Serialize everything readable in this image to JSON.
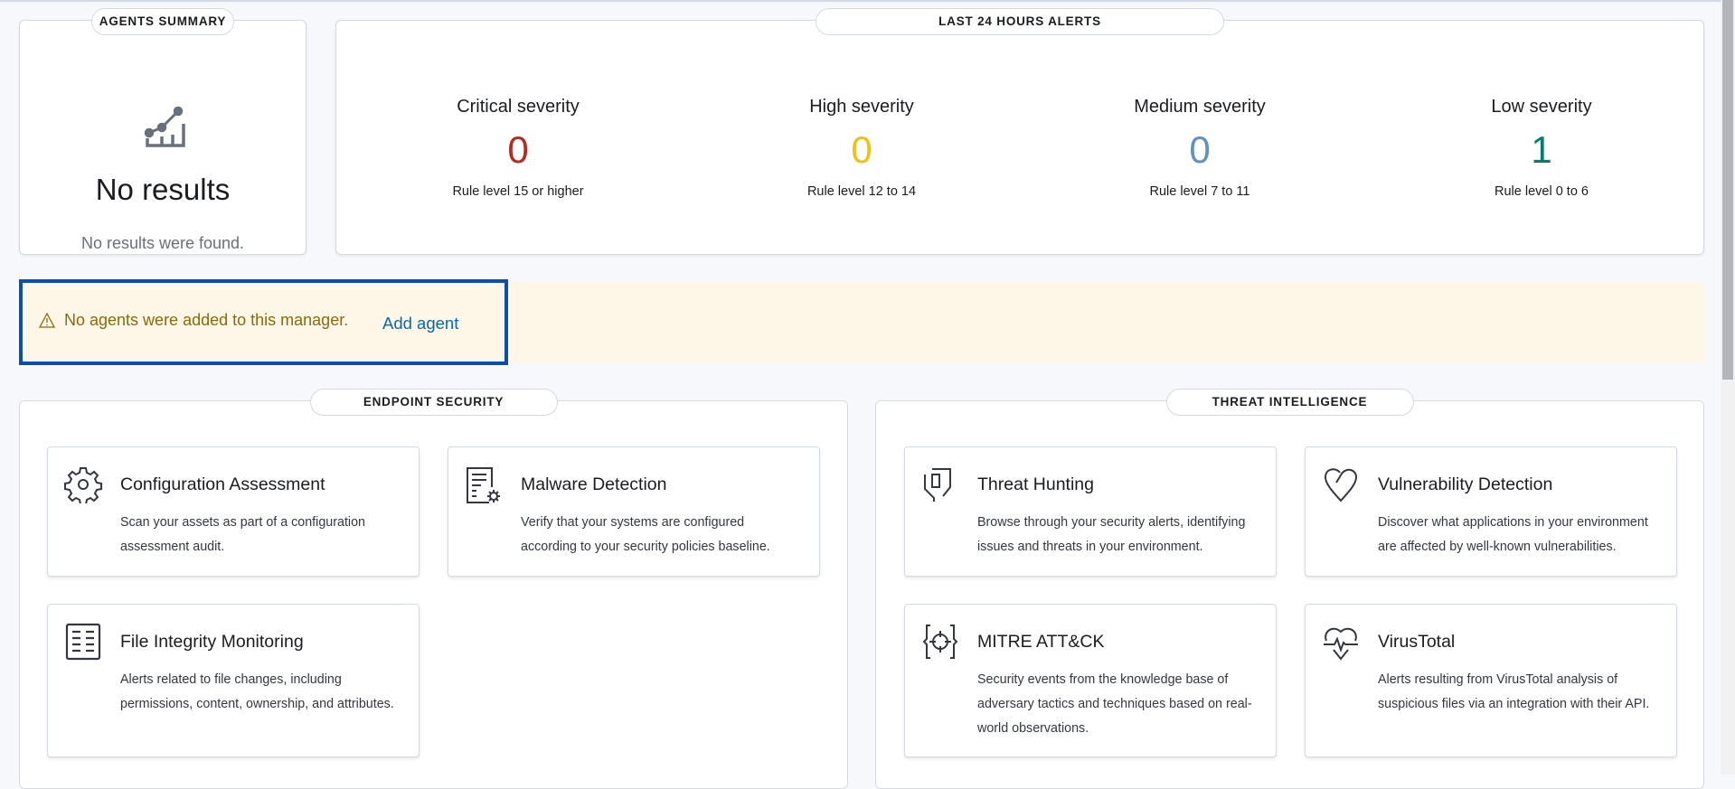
{
  "agents_summary": {
    "header": "AGENTS SUMMARY",
    "icon": "chart-line-icon",
    "title": "No results",
    "message": "No results were found."
  },
  "alerts": {
    "header": "LAST 24 HOURS ALERTS",
    "items": [
      {
        "title": "Critical severity",
        "value": "0",
        "subtitle": "Rule level 15 or higher",
        "color": "#bd271e"
      },
      {
        "title": "High severity",
        "value": "0",
        "subtitle": "Rule level 12 to 14",
        "color": "#f5c00b"
      },
      {
        "title": "Medium severity",
        "value": "0",
        "subtitle": "Rule level 7 to 11",
        "color": "#6092c0"
      },
      {
        "title": "Low severity",
        "value": "1",
        "subtitle": "Rule level 0 to 6",
        "color": "#017d73"
      }
    ]
  },
  "warning": {
    "icon": "warning-icon",
    "message": "No agents were added to this manager.",
    "link": "Add agent"
  },
  "endpoint_security": {
    "header": "ENDPOINT SECURITY",
    "cards": [
      {
        "title": "Configuration Assessment",
        "description": "Scan your assets as part of a configuration assessment audit.",
        "icon": "gear-icon"
      },
      {
        "title": "Malware Detection",
        "description": "Verify that your systems are configured according to your security policies baseline.",
        "icon": "document-gear-icon"
      },
      {
        "title": "File Integrity Monitoring",
        "description": "Alerts related to file changes, including permissions, content, ownership, and attributes.",
        "icon": "list-document-icon"
      }
    ]
  },
  "threat_intelligence": {
    "header": "THREAT INTELLIGENCE",
    "cards": [
      {
        "title": "Threat Hunting",
        "description": "Browse through your security alerts, identifying issues and threats in your environment.",
        "icon": "shield-icon"
      },
      {
        "title": "Vulnerability Detection",
        "description": "Discover what applications in your environment are affected by well-known vulnerabilities.",
        "icon": "broken-heart-icon"
      },
      {
        "title": "MITRE ATT&CK",
        "description": "Security events from the knowledge base of adversary tactics and techniques based on real-world observations.",
        "icon": "target-braces-icon"
      },
      {
        "title": "VirusTotal",
        "description": "Alerts resulting from VirusTotal analysis of suspicious files via an integration with their API.",
        "icon": "heart-pulse-icon"
      }
    ]
  }
}
